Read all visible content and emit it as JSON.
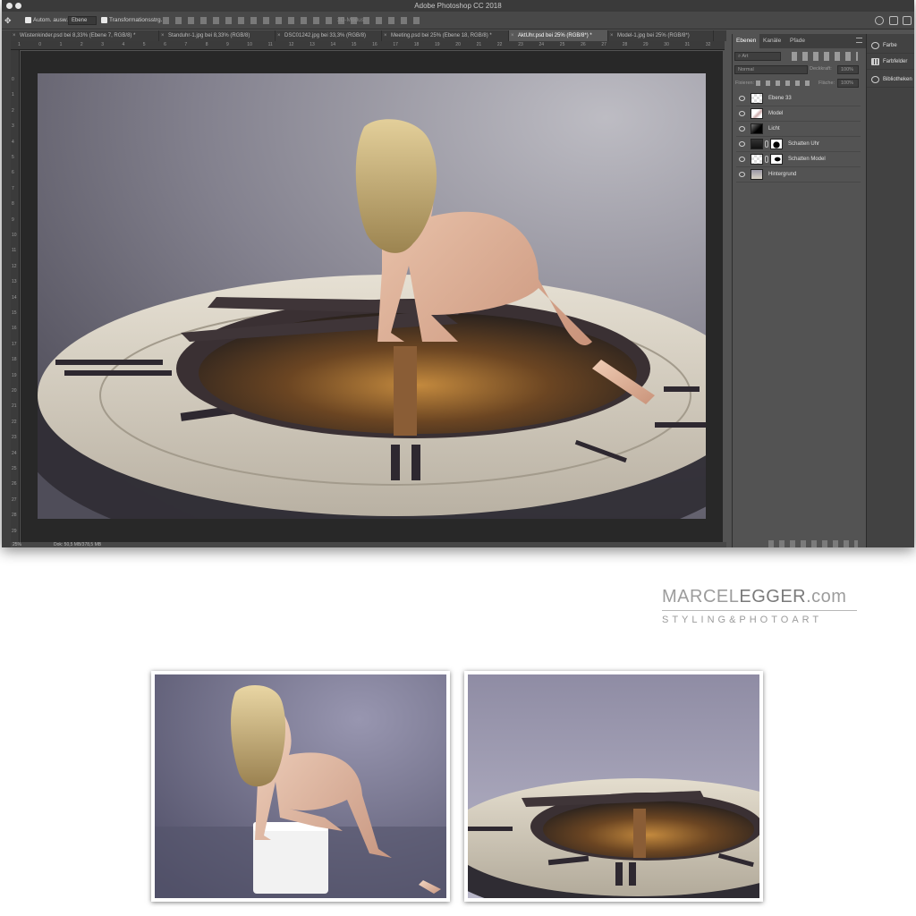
{
  "window": {
    "title": "Adobe Photoshop CC 2018"
  },
  "options_bar": {
    "auto_select_label": "Autom. ausw.:",
    "auto_select_value": "Ebene",
    "transform_label": "Transformationsstrg.",
    "mode_3d_label": "3D-Modus:"
  },
  "document_tabs": [
    {
      "label": "Wüstenkinder.psd bei 8,33% (Ebene 7, RGB/8) *"
    },
    {
      "label": "Standuhr-1.jpg bei 8,33% (RGB/8)"
    },
    {
      "label": "DSC01242.jpg bei 33,3% (RGB/8)"
    },
    {
      "label": "Meeting.psd bei 25% (Ebene 18, RGB/8) *"
    },
    {
      "label": "AktUhr.psd bei 25% (RGB/8*) *"
    },
    {
      "label": "Model-1.jpg bei 25% (RGB/8*)"
    }
  ],
  "ruler_h": [
    "1",
    "0",
    "1",
    "2",
    "3",
    "4",
    "5",
    "6",
    "7",
    "8",
    "9",
    "10",
    "11",
    "12",
    "13",
    "14",
    "15",
    "16",
    "17",
    "18",
    "19",
    "20",
    "21",
    "22",
    "23",
    "24",
    "25",
    "26",
    "27",
    "28",
    "29",
    "30",
    "31",
    "32"
  ],
  "ruler_v": [
    "0",
    "1",
    "2",
    "3",
    "4",
    "5",
    "6",
    "7",
    "8",
    "9",
    "10",
    "11",
    "12",
    "13",
    "14",
    "15",
    "16",
    "17",
    "18",
    "19",
    "20",
    "21",
    "22",
    "23",
    "24",
    "25",
    "26",
    "27",
    "28",
    "29",
    "30"
  ],
  "status_bar": {
    "zoom": "25%",
    "doc_info": "Dok: 50,5 MB/378,5 MB"
  },
  "layers_panel": {
    "tabs": [
      "Ebenen",
      "Kanäle",
      "Pfade"
    ],
    "filter_kind": "Art",
    "blend_mode": "Normal",
    "opacity_label": "Deckkraft:",
    "opacity_value": "100%",
    "fill_label": "Fläche:",
    "fill_value": "100%",
    "lock_label": "Fixieren:",
    "layers": [
      {
        "name": "Ebene 33"
      },
      {
        "name": "Model"
      },
      {
        "name": "Licht"
      },
      {
        "name": "Schatten Uhr"
      },
      {
        "name": "Schatten Model"
      },
      {
        "name": "Hintergrund"
      }
    ]
  },
  "dock": {
    "items": [
      "Farbe",
      "Farbfelder",
      "Bibliotheken"
    ]
  },
  "branding": {
    "name_light": "MARCEL",
    "name_bold": "EGGER",
    "domain": ".com",
    "tagline": "STYLING&PHOTOART"
  },
  "colors": {
    "ui_dark": "#535353",
    "pasteboard": "#282828",
    "background_wall": "#9b98a6",
    "dial": "#ddd7cb"
  }
}
